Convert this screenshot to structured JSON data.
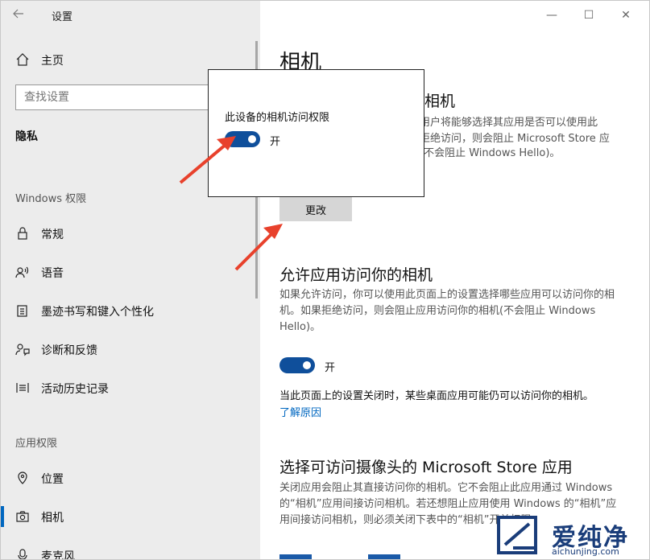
{
  "window": {
    "title": "设置"
  },
  "sidebar": {
    "home": "主页",
    "search_placeholder": "查找设置",
    "section": "隐私",
    "groups": [
      "Windows 权限",
      "应用权限"
    ],
    "items": [
      {
        "label": "常规",
        "icon": "lock-icon"
      },
      {
        "label": "语音",
        "icon": "speech-icon"
      },
      {
        "label": "墨迹书写和键入个性化",
        "icon": "clipboard-icon"
      },
      {
        "label": "诊断和反馈",
        "icon": "person-feedback-icon"
      },
      {
        "label": "活动历史记录",
        "icon": "history-icon"
      },
      {
        "label": "位置",
        "icon": "location-icon"
      },
      {
        "label": "相机",
        "icon": "camera-icon"
      },
      {
        "label": "麦克风",
        "icon": "microphone-icon"
      }
    ]
  },
  "main": {
    "title": "相机",
    "device_heading_tail": "相机",
    "device_desc": [
      "用户将能够选择其应用是否可以使用此",
      "拒绝访问，则会阻止 Microsoft Store 应",
      "(不会阻止 Windows Hello)。"
    ],
    "change_button": "更改",
    "apps_heading": "允许应用访问你的相机",
    "apps_desc": "如果允许访问，你可以使用此页面上的设置选择哪些应用可以访问你的相机。如果拒绝访问，则会阻止应用访问你的相机(不会阻止 Windows Hello)。",
    "toggle_label": "开",
    "note": "当此页面上的设置关闭时，某些桌面应用可能仍可以访问你的相机。",
    "learn_more": "了解原因",
    "store_heading": "选择可访问摄像头的 Microsoft Store 应用",
    "store_desc": "关闭应用会阻止其直接访问你的相机。它不会阻止此应用通过 Windows 的“相机”应用间接访问相机。若还想阻止应用使用 Windows 的“相机”应用间接访问相机，则必须关闭下表中的“相机”开关权限。"
  },
  "popup": {
    "title": "此设备的相机访问权限",
    "toggle_label": "开"
  },
  "watermark": {
    "text": "爱纯净",
    "url": "aichunjing.com"
  },
  "colors": {
    "accent": "#0f4f9b",
    "annotation": "#e8412c",
    "sidebar_bg": "#ececec"
  }
}
